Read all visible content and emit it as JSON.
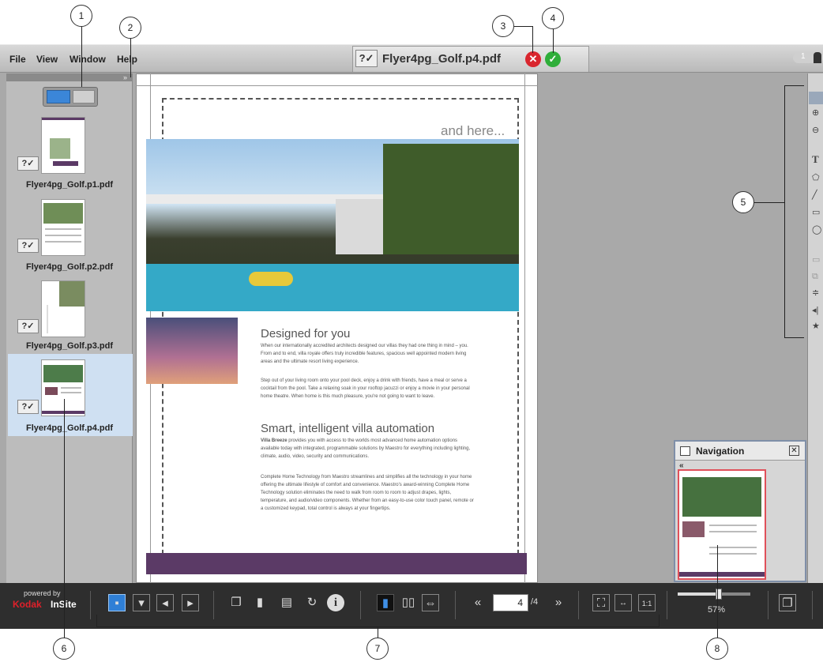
{
  "menu": {
    "file": "File",
    "view": "View",
    "window": "Window",
    "help": "Help"
  },
  "document": {
    "title": "Flyer4pg_Golf.p4.pdf",
    "status_mark": "?✓"
  },
  "user": {
    "badge": "1"
  },
  "pages": [
    {
      "label": "Flyer4pg_Golf.p1.pdf",
      "status_mark": "?✓"
    },
    {
      "label": "Flyer4pg_Golf.p2.pdf",
      "status_mark": "?✓"
    },
    {
      "label": "Flyer4pg_Golf.p3.pdf",
      "status_mark": "?✓"
    },
    {
      "label": "Flyer4pg_Golf.p4.pdf",
      "status_mark": "?✓"
    }
  ],
  "flyer": {
    "tagline": "and here...",
    "heading1": "Designed for you",
    "para1": "When our internationally accredited architects designed our villas they had one thing in mind – you. From and to end, villa royale offers truly incredible features, spacious well appointed modern living areas and the ultimate resort living experience.",
    "para2": "Step out of your living room onto your pool deck, enjoy a drink with friends, have a meal or serve a cocktail from the pool. Take a relaxing soak in your rooftop jacuzzi or enjoy a movie in your personal home theatre. When home is this much pleasure, you're not going to want to leave.",
    "heading2": "Smart, intelligent villa automation",
    "para3_lead": "Villa Breeze",
    "para3": " provides you with access to the worlds most advanced home automation options available today with integrated, programmable solutions by Maestro for everything including lighting, climate, audio, video, security and communications.",
    "para4": "Complete Home Technology from Maestro streamlines and simplifies all the technology in your home offering the ultimate lifestyle of comfort and convenience. Maestro's award-winning Complete Home Technology solution eliminates the need to walk from room to room to adjust drapes, lights, temperature, and audio/video components. Whether from an easy-to-use color touch panel, remote or a customized keypad, total control is always at your fingertips."
  },
  "navigation": {
    "title": "Navigation",
    "back": "«"
  },
  "statusbar": {
    "powered_by": "powered by",
    "brand_kodak": "Kodak",
    "brand_insite": "InSite",
    "page_current": "4",
    "page_total": "/4",
    "zoom": "57%",
    "zoom_level": 0.57
  },
  "callouts": [
    "1",
    "2",
    "3",
    "4",
    "5",
    "6",
    "7",
    "8"
  ],
  "colors": {
    "accept": "#2fae3a",
    "reject": "#d9262e",
    "purple_band": "#5b3a66",
    "accent_blue": "#2f7fd6"
  }
}
